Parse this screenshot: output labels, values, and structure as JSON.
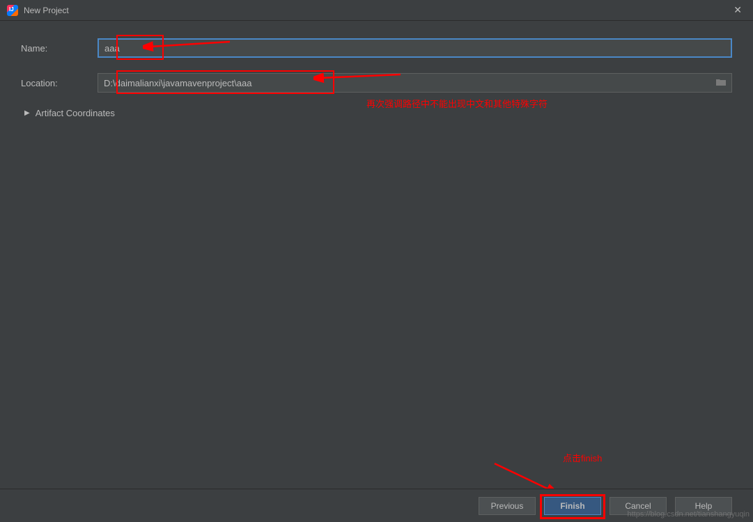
{
  "window": {
    "title": "New Project"
  },
  "form": {
    "name_label": "Name:",
    "name_value": "aaa",
    "location_label": "Location:",
    "location_value": "D:\\daimalianxi\\javamavenproject\\aaa"
  },
  "artifact": {
    "label": "Artifact Coordinates"
  },
  "annotations": {
    "location_note": "再次强调路径中不能出现中文和其他特殊字符",
    "finish_note": "点击finish"
  },
  "buttons": {
    "previous": "Previous",
    "finish": "Finish",
    "cancel": "Cancel",
    "help": "Help"
  },
  "watermark": "https://blog.csdn.net/tianshangyuqin"
}
